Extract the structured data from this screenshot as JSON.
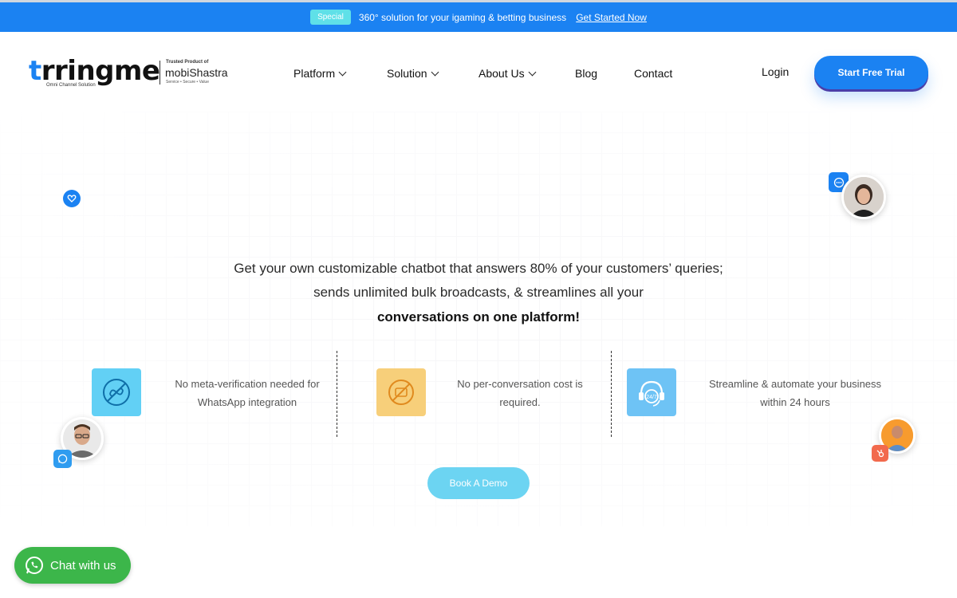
{
  "topbar": {
    "badge": "Special",
    "text": "360° solution for your igaming & betting business",
    "link": "Get Started Now",
    "color": "#1b82f2"
  },
  "logo": {
    "name": "trringme",
    "tagline": "Omni Channel Solution",
    "trusted": "Trusted Product of",
    "parent": "mobiShastra",
    "parent_tag": "Service • Secure • Value"
  },
  "nav": {
    "items": [
      {
        "label": "Platform",
        "dropdown": true
      },
      {
        "label": "Solution",
        "dropdown": true
      },
      {
        "label": "About Us",
        "dropdown": true
      },
      {
        "label": "Blog",
        "dropdown": false
      },
      {
        "label": "Contact",
        "dropdown": false
      }
    ],
    "login": "Login",
    "cta": "Start Free Trial"
  },
  "hero": {
    "line1": "Get your own customizable chatbot that answers 80% of your customers’ queries;",
    "line2": "sends unlimited bulk broadcasts, & streamlines all your",
    "line3": "conversations on one platform!"
  },
  "features": [
    {
      "icon": "no-meta-icon",
      "line1": "No meta-verification needed for",
      "line2": "WhatsApp integration",
      "color": "#62d0f5"
    },
    {
      "icon": "no-cost-icon",
      "line1": "No per-conversation cost is",
      "line2": "required.",
      "color": "#f7cf7a"
    },
    {
      "icon": "support-24-7-icon",
      "line1": "Streamline & automate your business",
      "line2": "within 24 hours",
      "color": "#6ec3f5"
    }
  ],
  "demo_button": "Book A Demo",
  "chat_button": "Chat with us",
  "float_icons": {
    "bot": "24/7"
  }
}
